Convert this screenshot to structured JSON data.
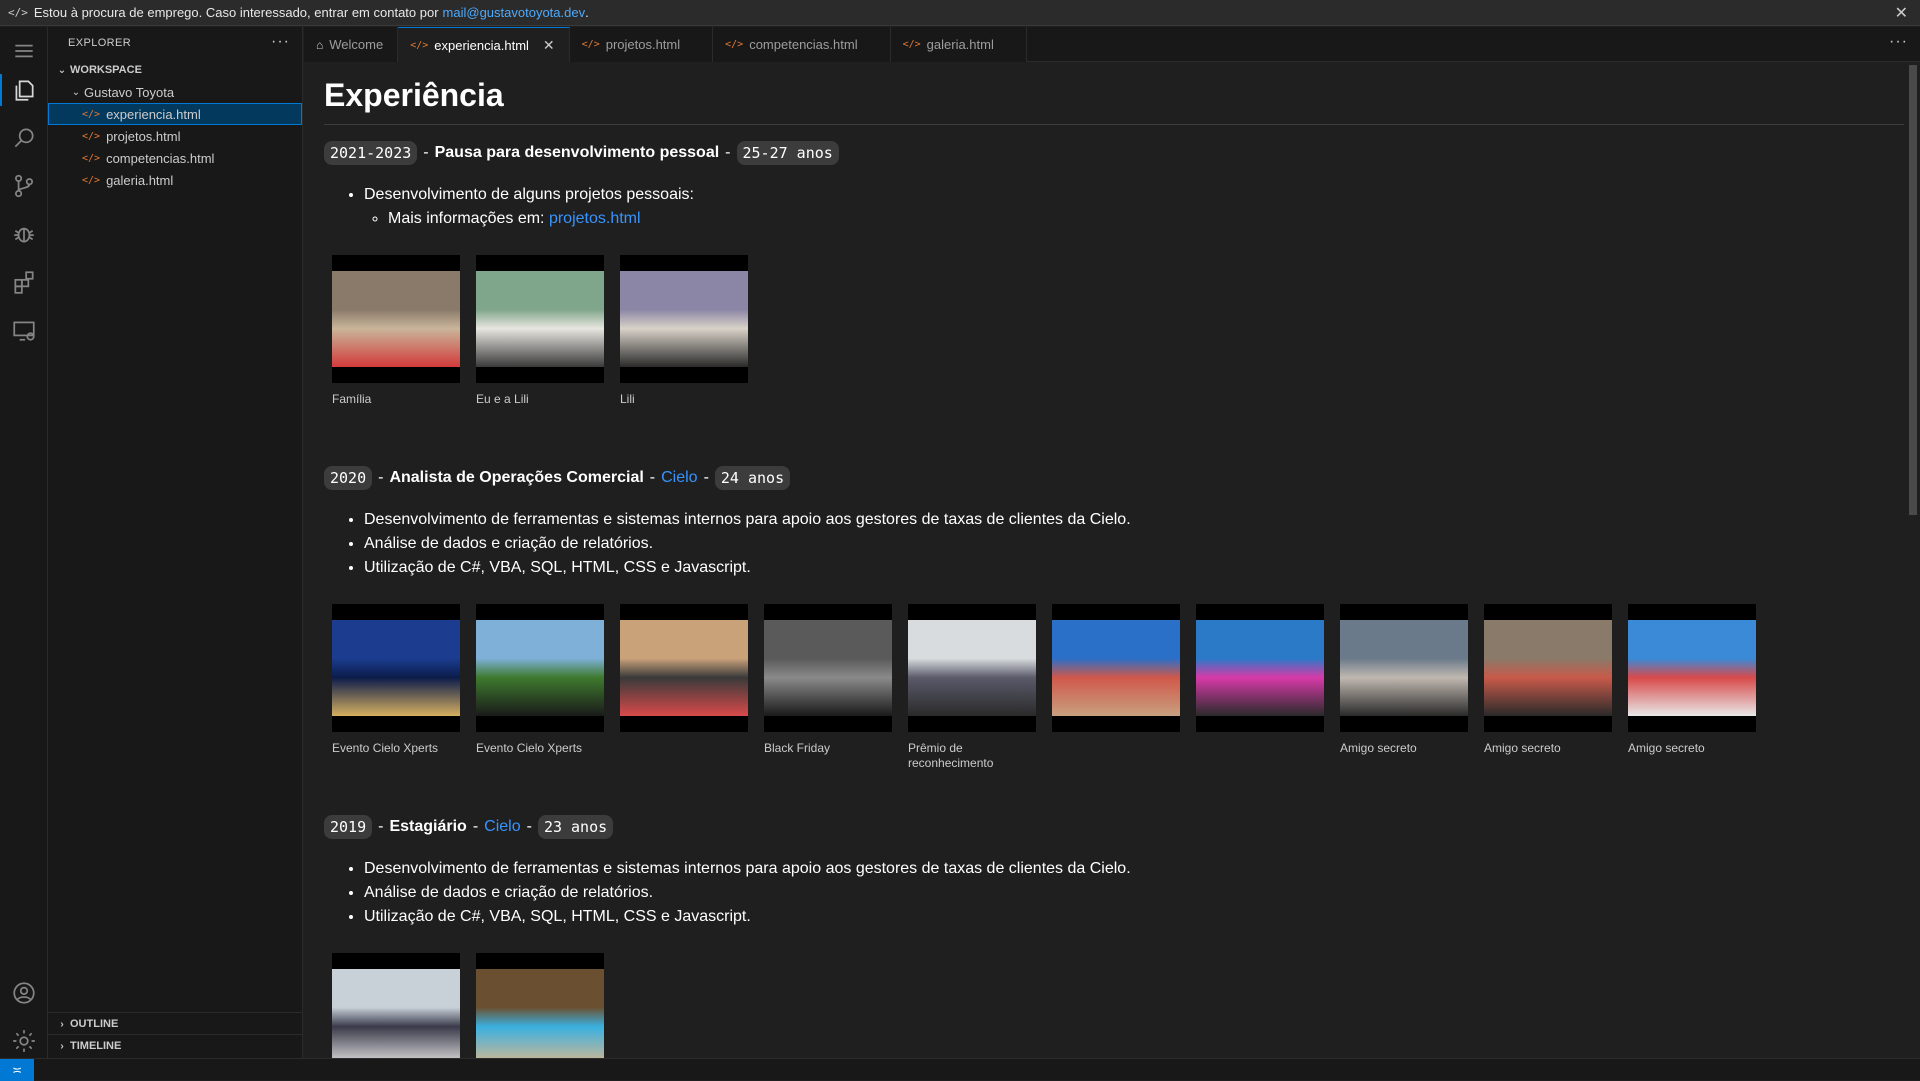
{
  "banner": {
    "text": "Estou à procura de emprego. Caso interessado, entrar em contato por",
    "email": "mail@gustavotoyota.dev",
    "suffix": ".",
    "close_glyph": "✕"
  },
  "activity_bar": {
    "icons": [
      "menu-icon",
      "files-icon",
      "search-icon",
      "source-control-icon",
      "debug-icon",
      "extensions-icon",
      "remote-explorer-icon",
      "account-icon",
      "settings-gear-icon"
    ]
  },
  "sidebar": {
    "title": "EXPLORER",
    "more": "···",
    "workspace": "WORKSPACE",
    "folder": "Gustavo Toyota",
    "files": [
      {
        "name": "experiencia.html",
        "selected": true
      },
      {
        "name": "projetos.html",
        "selected": false
      },
      {
        "name": "competencias.html",
        "selected": false
      },
      {
        "name": "galeria.html",
        "selected": false
      }
    ],
    "outline": "OUTLINE",
    "timeline": "TIMELINE"
  },
  "tabs": [
    {
      "label": "Welcome",
      "icon": "home-icon",
      "active": false
    },
    {
      "label": "experiencia.html",
      "icon": "html-file-icon",
      "active": true
    },
    {
      "label": "projetos.html",
      "icon": "html-file-icon",
      "active": false
    },
    {
      "label": "competencias.html",
      "icon": "html-file-icon",
      "active": false
    },
    {
      "label": "galeria.html",
      "icon": "html-file-icon",
      "active": false
    }
  ],
  "tabs_more": "···",
  "page": {
    "title": "Experiência",
    "entries": [
      {
        "years": "2021-2023",
        "role": "Pausa para desenvolvimento pessoal",
        "age": "25-27 anos",
        "bullets": [
          "Desenvolvimento de alguns projetos pessoais:"
        ],
        "sub_prefix": "Mais informações em:",
        "sub_link": "projetos.html",
        "photos": [
          {
            "caption": "Família",
            "colors": [
              "#8a7a6a",
              "#c9b59a",
              "#d23a3a"
            ]
          },
          {
            "caption": "Eu e a Lili",
            "colors": [
              "#7fa58a",
              "#e8e6e0",
              "#3a3a3a"
            ]
          },
          {
            "caption": "Lili",
            "colors": [
              "#8c86a6",
              "#d8d2c8",
              "#2a2a2a"
            ]
          }
        ]
      },
      {
        "years": "2020",
        "role": "Analista de Operações Comercial",
        "company": "Cielo",
        "age": "24 anos",
        "bullets": [
          "Desenvolvimento de ferramentas e sistemas internos para apoio aos gestores de taxas de clientes da Cielo.",
          "Análise de dados e criação de relatórios.",
          "Utilização de C#, VBA, SQL, HTML, CSS e Javascript."
        ],
        "photos": [
          {
            "caption": "Evento Cielo Xperts",
            "colors": [
              "#1b3c8f",
              "#0c1c4a",
              "#d6b060"
            ]
          },
          {
            "caption": "Evento Cielo Xperts",
            "colors": [
              "#7eb0d8",
              "#3e7a2e",
              "#1a1a1a"
            ]
          },
          {
            "caption": "",
            "colors": [
              "#c9a27a",
              "#3a3a3a",
              "#d84a4a"
            ]
          },
          {
            "caption": "Black Friday",
            "colors": [
              "#5a5a5a",
              "#8a8a8a",
              "#1a1a1a"
            ]
          },
          {
            "caption": "Prêmio de reconhecimento",
            "colors": [
              "#d8dcde",
              "#5a5a6a",
              "#2a2a2a"
            ]
          },
          {
            "caption": "",
            "colors": [
              "#2a6fc8",
              "#d0584a",
              "#c8a080"
            ]
          },
          {
            "caption": "",
            "colors": [
              "#2a7ac8",
              "#d83aa8",
              "#2a2a2a"
            ]
          },
          {
            "caption": "Amigo secreto",
            "colors": [
              "#6a7a8a",
              "#c0b8b0",
              "#2a2a2a"
            ]
          },
          {
            "caption": "Amigo secreto",
            "colors": [
              "#8a7a6a",
              "#c85a4a",
              "#2a2a2a"
            ]
          },
          {
            "caption": "Amigo secreto",
            "colors": [
              "#3a8ad8",
              "#d84a4a",
              "#e8e8e8"
            ]
          }
        ]
      },
      {
        "years": "2019",
        "role": "Estagiário",
        "company": "Cielo",
        "age": "23 anos",
        "bullets": [
          "Desenvolvimento de ferramentas e sistemas internos para apoio aos gestores de taxas de clientes da Cielo.",
          "Análise de dados e criação de relatórios.",
          "Utilização de C#, VBA, SQL, HTML, CSS e Javascript."
        ],
        "photos": [
          {
            "caption": "",
            "colors": [
              "#c8d0d8",
              "#3a3a4a",
              "#e0e0e0"
            ]
          },
          {
            "caption": "",
            "colors": [
              "#6a5030",
              "#3ab0e0",
              "#d8b890"
            ]
          }
        ]
      }
    ]
  },
  "status": {
    "remote_glyph": "≍"
  }
}
